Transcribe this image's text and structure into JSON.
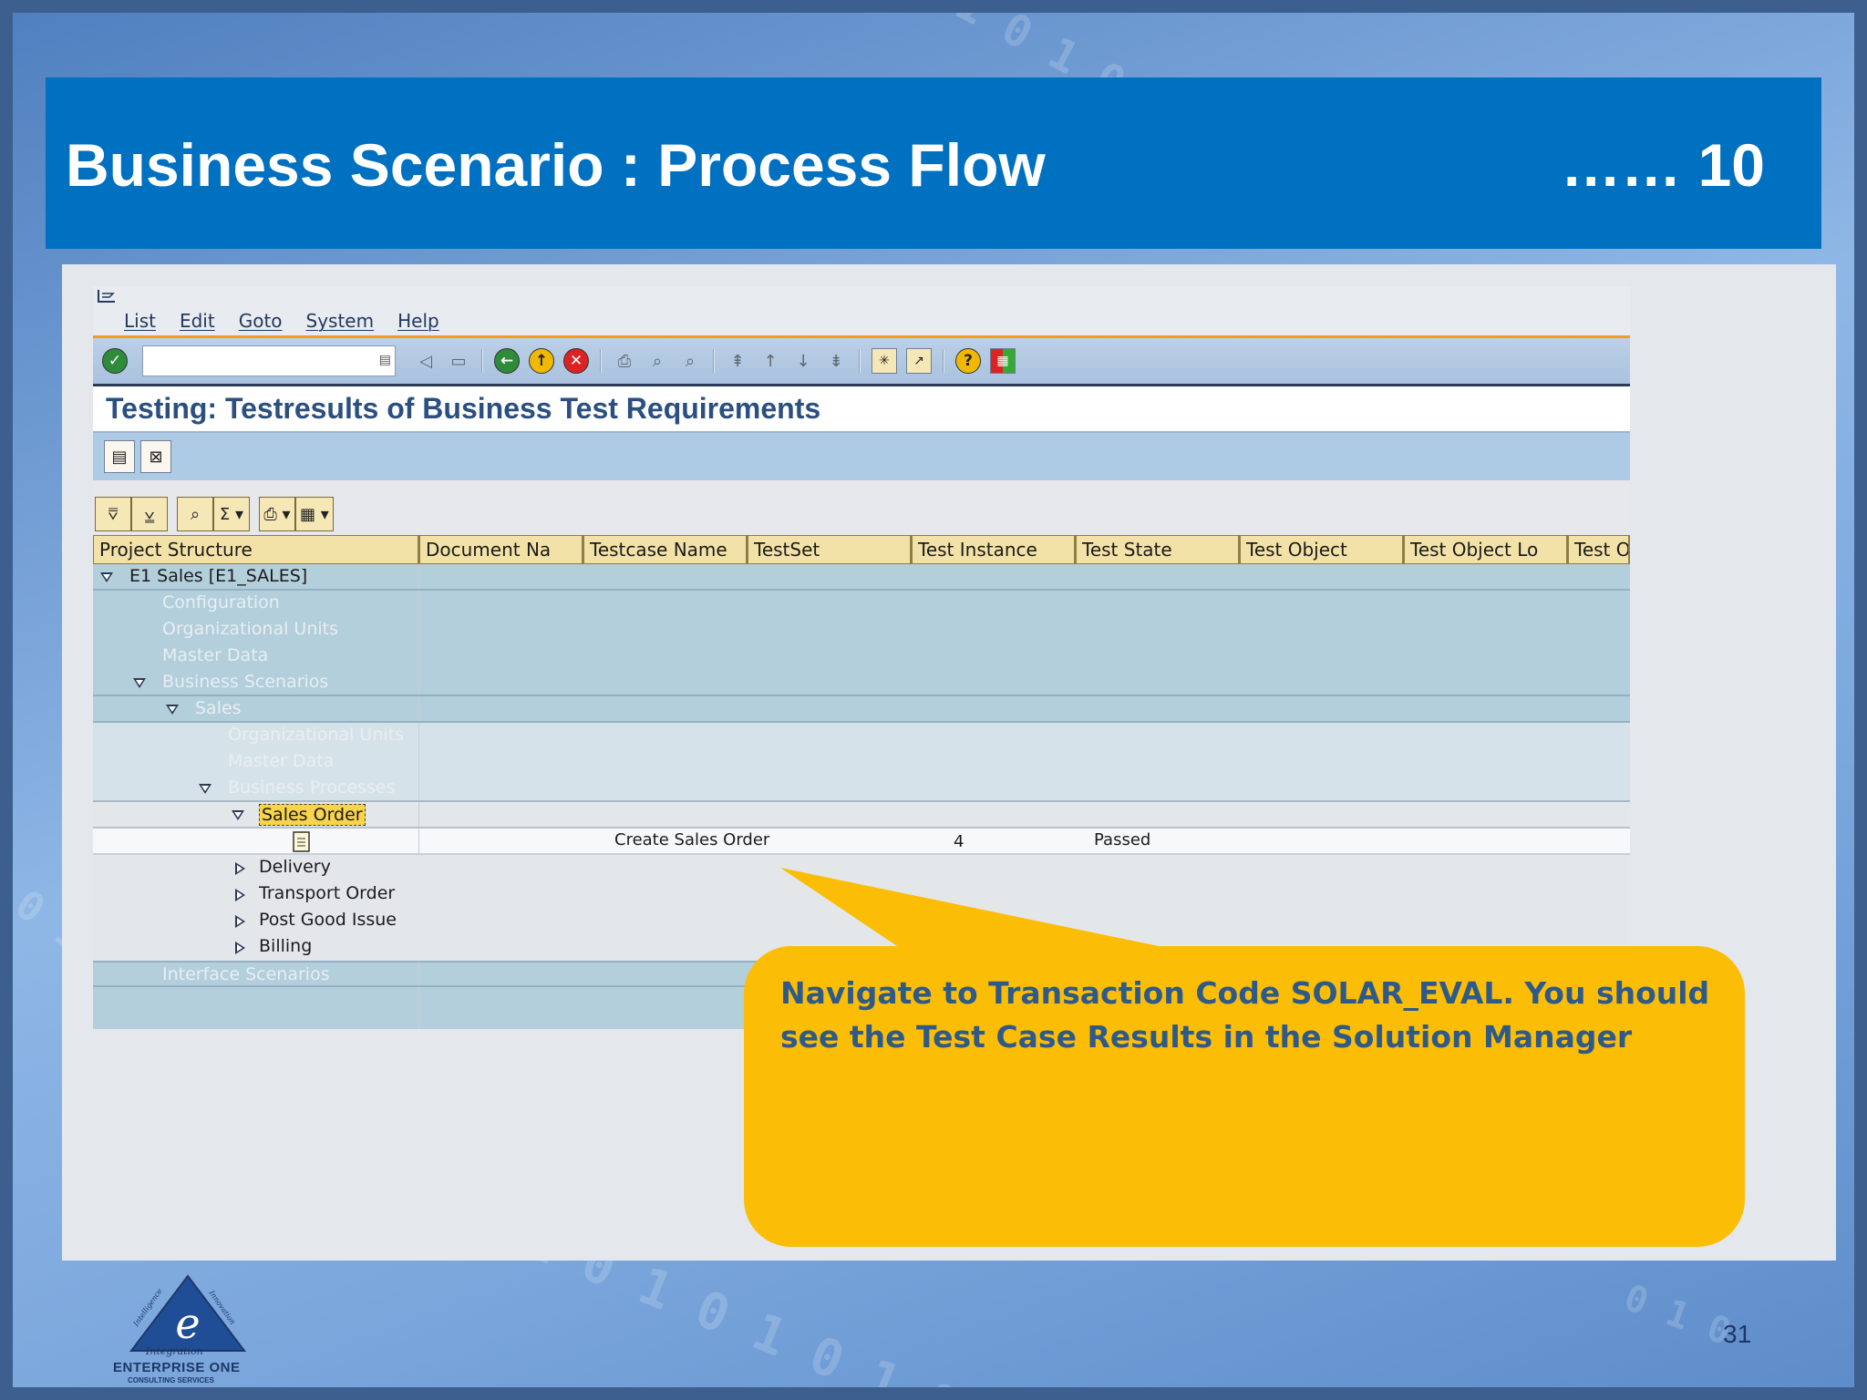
{
  "slide": {
    "title": "Business Scenario : Process Flow",
    "step_number": "…… 10",
    "page_number": "31"
  },
  "sap": {
    "menu": [
      "List",
      "Edit",
      "Goto",
      "System",
      "Help"
    ],
    "screen_title": "Testing: Testresults of Business Test Requirements",
    "columns": [
      "Project Structure",
      "Document Na",
      "Testcase Name",
      "TestSet",
      "Test Instance",
      "Test State",
      "Test Object",
      "Test Object Lo",
      "Test O"
    ],
    "tree": [
      {
        "label": "E1 Sales [E1_SALES]"
      },
      {
        "label": "Configuration"
      },
      {
        "label": "Organizational Units"
      },
      {
        "label": "Master Data"
      },
      {
        "label": "Business Scenarios"
      },
      {
        "label": "Sales"
      },
      {
        "label": "Organizational Units"
      },
      {
        "label": "Master Data"
      },
      {
        "label": "Business Processes"
      },
      {
        "label": "Sales Order"
      },
      {
        "label": ""
      },
      {
        "label": "Delivery"
      },
      {
        "label": "Transport Order"
      },
      {
        "label": "Post Good Issue"
      },
      {
        "label": "Billing"
      },
      {
        "label": "Interface Scenarios"
      }
    ],
    "result_row": {
      "testcase_name": "Create Sales Order",
      "test_instance": "4",
      "test_state": "Passed"
    }
  },
  "callout": {
    "text": "Navigate to Transaction Code SOLAR_EVAL.  You should see the Test Case Results in the Solution Manager"
  },
  "logo": {
    "name": "ENTERPRISE ONE",
    "subtitle": "CONSULTING SERVICES",
    "tagline": "Integration",
    "words": [
      "Intelligence",
      "Innovation"
    ]
  },
  "colors": {
    "banner": "#0070c0",
    "callout": "#fbbd06",
    "callout_text": "#2e5a8a"
  }
}
